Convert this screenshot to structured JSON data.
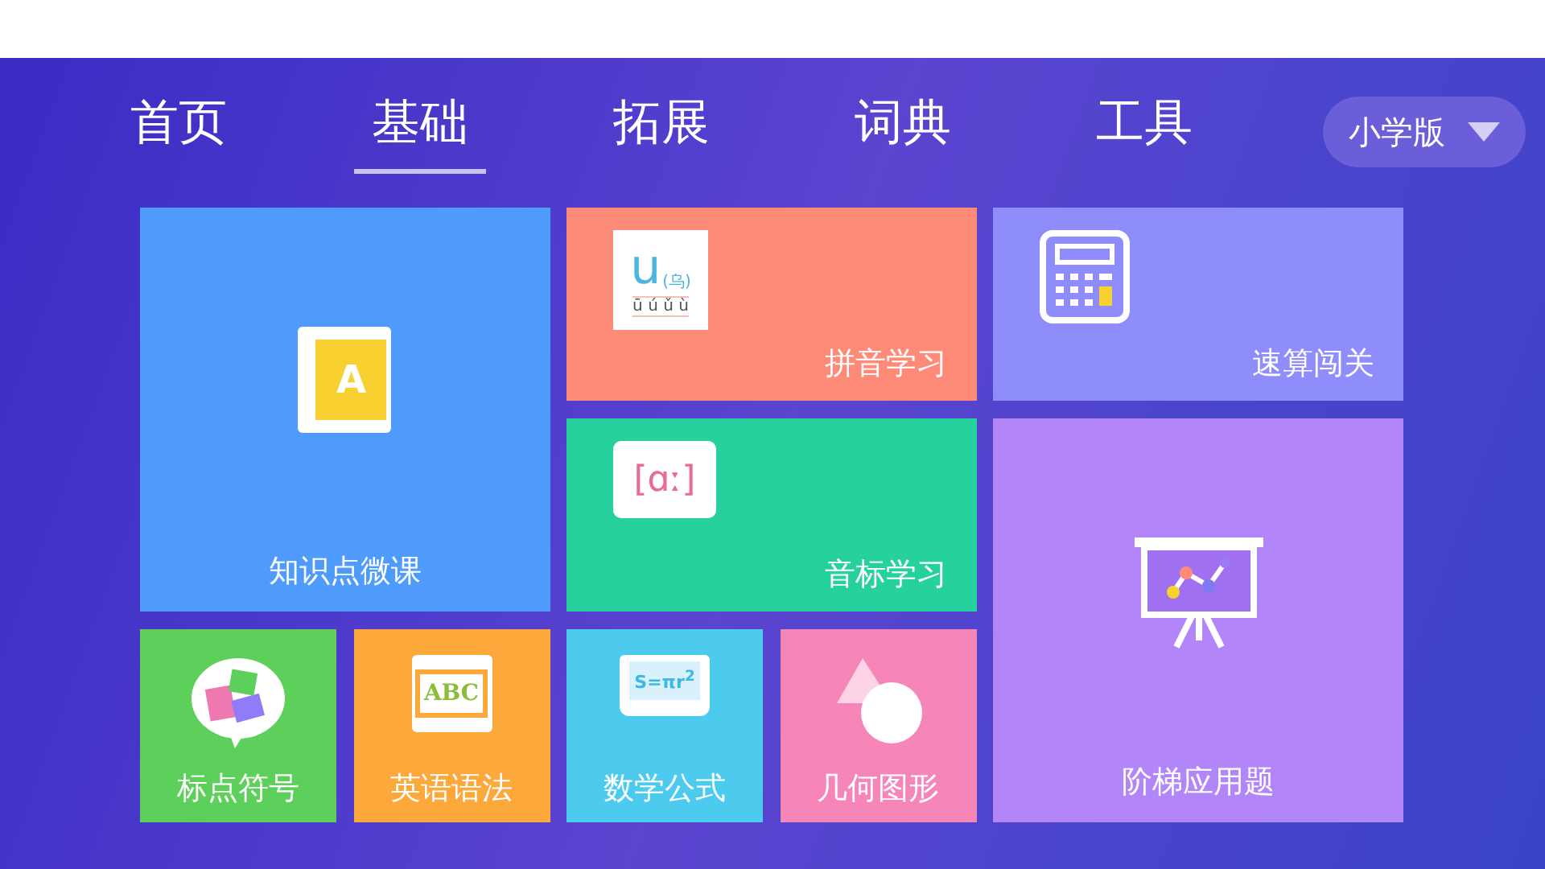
{
  "nav": {
    "tabs": [
      {
        "label": "首页",
        "selected": false
      },
      {
        "label": "基础",
        "selected": true
      },
      {
        "label": "拓展",
        "selected": false
      },
      {
        "label": "词典",
        "selected": false
      },
      {
        "label": "工具",
        "selected": false
      }
    ],
    "grade_dropdown": {
      "value": "小学版"
    }
  },
  "tiles": [
    {
      "label": "知识点微课",
      "kind": "book",
      "color": "#4f9bfb",
      "icon_texts": [
        "A"
      ]
    },
    {
      "label": "拼音学习",
      "kind": "pinyin",
      "color": "#fe8a78",
      "icon_texts": [
        "u",
        "(乌)",
        "ū ú ǔ ù"
      ]
    },
    {
      "label": "速算闯关",
      "kind": "calculator",
      "color": "#8f8cfb"
    },
    {
      "label": "音标学习",
      "kind": "phonetic",
      "color": "#27d19e",
      "icon_texts": [
        "[ɑː]"
      ]
    },
    {
      "label": "标点符号",
      "kind": "punctuation",
      "color": "#5cd05a"
    },
    {
      "label": "英语语法",
      "kind": "abc",
      "color": "#fca83a",
      "icon_texts": [
        "ABC"
      ]
    },
    {
      "label": "数学公式",
      "kind": "formula",
      "color": "#4ccbee",
      "icon_texts": [
        "S=πr$^{2}$"
      ]
    },
    {
      "label": "几何图形",
      "kind": "geometry",
      "color": "#f786b8"
    },
    {
      "label": "阶梯应用题",
      "kind": "presentation",
      "color": "#b286f9"
    }
  ]
}
